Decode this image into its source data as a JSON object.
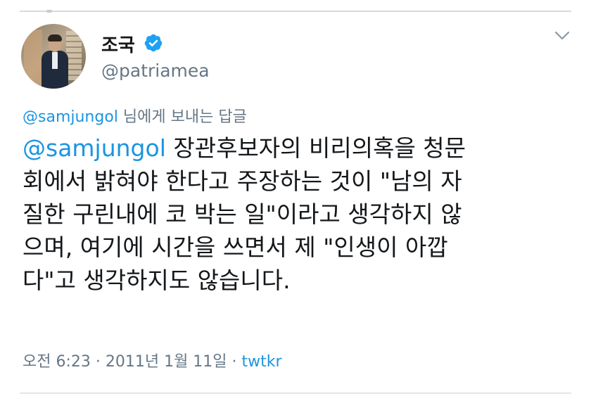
{
  "tweet": {
    "author_name": "조국",
    "author_handle": "@patriamea",
    "reply_to_handle": "@samjungol",
    "reply_to_suffix": " 님에게 보내는 답글",
    "mention": "@samjungol",
    "lines": [
      " 장관후보자의 비리의혹을 청문",
      "회에서 밝혀야 한다고 주장하는 것이 \"남의 자",
      "질한 구린내에 코 박는 일\"이라고 생각하지 않",
      "으며, 여기에 시간을 쓰면서 제 \"인생이 아깝",
      "다\"고 생각하지도 않습니다."
    ],
    "timestamp": "오전 6:23 · 2011년 1월 11일 · ",
    "source": "twtkr"
  },
  "icons": {
    "verified": "verified-badge-icon",
    "menu": "chevron-down-icon"
  },
  "colors": {
    "link": "#1b95e0",
    "secondary_text": "#657786",
    "verified_badge": "#1da1f2"
  }
}
